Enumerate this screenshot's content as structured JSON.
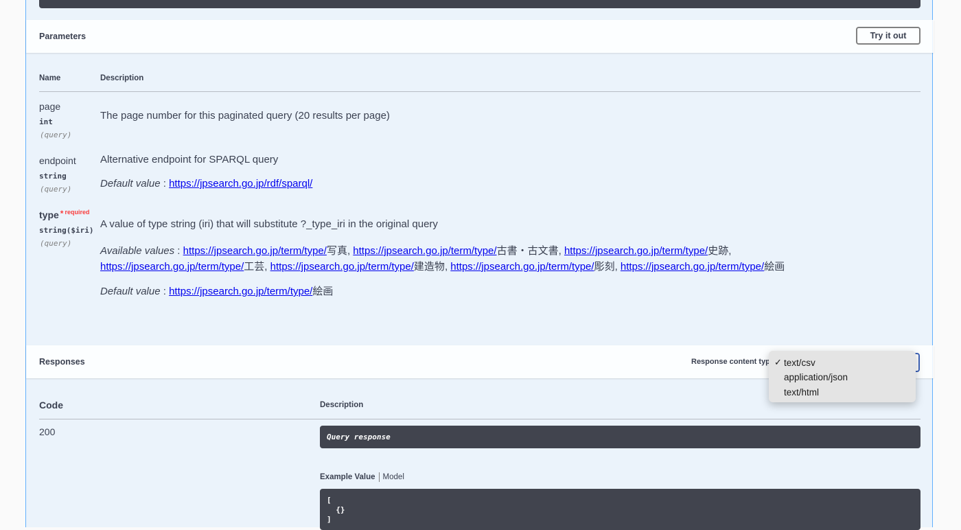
{
  "parameters": {
    "title": "Parameters",
    "try_button": "Try it out",
    "col_name": "Name",
    "col_description": "Description",
    "items": [
      {
        "name": "page",
        "type": "int",
        "in": "(query)",
        "description": "The page number for this paginated query (20 results per page)"
      },
      {
        "name": "endpoint",
        "type": "string",
        "in": "(query)",
        "description": "Alternative endpoint for SPARQL query",
        "default_label": "Default value",
        "default_value": "https://jpsearch.go.jp/rdf/sparql/"
      },
      {
        "name": "type",
        "required_star": "*",
        "required_label": "required",
        "type": "string($iri)",
        "in": "(query)",
        "description": "A value of type string (iri) that will substitute ?_type_iri in the original query",
        "available_label": "Available values",
        "available": [
          {
            "link": "https://jpsearch.go.jp/term/type/",
            "suffix": "写真"
          },
          {
            "link": "https://jpsearch.go.jp/term/type/",
            "suffix": "古書・古文書"
          },
          {
            "link": "https://jpsearch.go.jp/term/type/",
            "suffix": "史跡"
          },
          {
            "link": "https://jpsearch.go.jp/term/type/",
            "suffix": "工芸"
          },
          {
            "link": "https://jpsearch.go.jp/term/type/",
            "suffix": "建造物"
          },
          {
            "link": "https://jpsearch.go.jp/term/type/",
            "suffix": "彫刻"
          },
          {
            "link": "https://jpsearch.go.jp/term/type/",
            "suffix": "絵画"
          }
        ],
        "default_label": "Default value",
        "default_link": "https://jpsearch.go.jp/term/type/",
        "default_suffix": "絵画"
      }
    ]
  },
  "responses": {
    "title": "Responses",
    "content_type_label": "Response content type",
    "content_type_options": [
      "text/csv",
      "application/json",
      "text/html"
    ],
    "selected": "text/csv",
    "checkmark": "✓",
    "col_code": "Code",
    "col_description": "Description",
    "rows": [
      {
        "code": "200",
        "description": "Query response",
        "tab_example": "Example Value",
        "tab_model": "Model",
        "example": "[\n  {}\n]"
      }
    ]
  },
  "colors": {
    "accent_blue": "#61affe",
    "required_red": "#f93e3e",
    "code_bg": "#41444e",
    "select_border": "#3e63b8"
  }
}
